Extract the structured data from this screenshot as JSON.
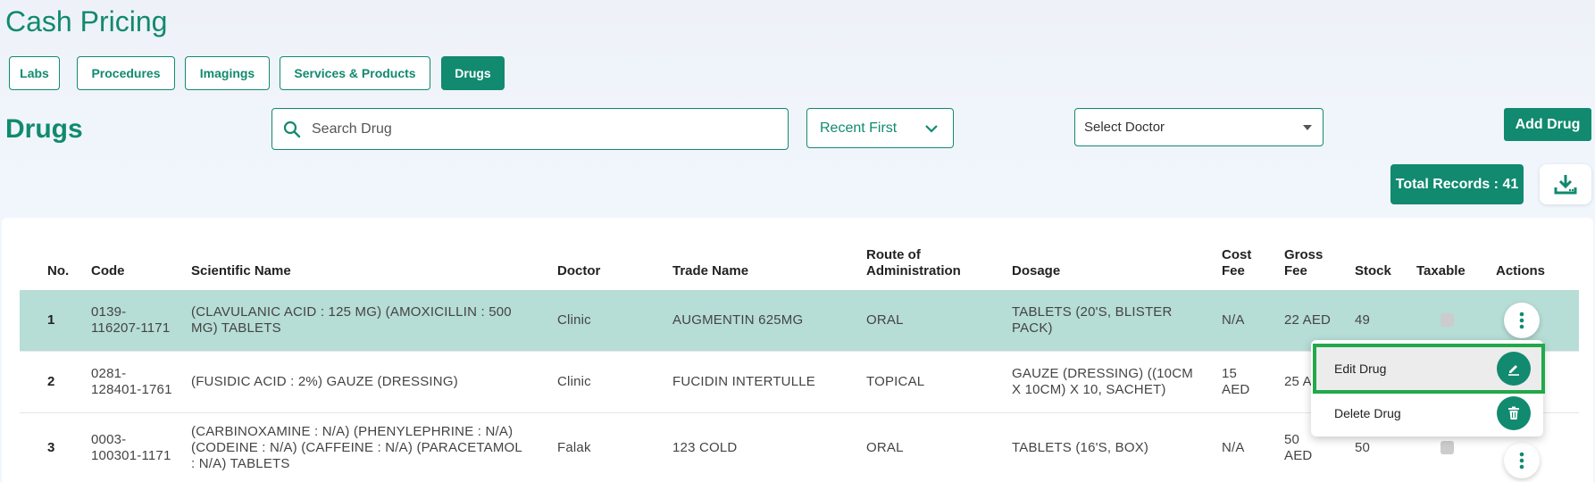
{
  "page": {
    "title": "Cash Pricing"
  },
  "tabs": [
    {
      "label": "Labs",
      "active": false
    },
    {
      "label": "Procedures",
      "active": false
    },
    {
      "label": "Imagings",
      "active": false
    },
    {
      "label": "Services & Products",
      "active": false
    },
    {
      "label": "Drugs",
      "active": true
    }
  ],
  "section": {
    "title": "Drugs"
  },
  "search": {
    "placeholder": "Search Drug",
    "value": ""
  },
  "sort": {
    "selected": "Recent First"
  },
  "doctor_filter": {
    "placeholder": "Select Doctor"
  },
  "add_button": {
    "label": "Add Drug"
  },
  "total": {
    "label": "Total Records : 41"
  },
  "table": {
    "headers": {
      "no": "No.",
      "code": "Code",
      "scientific": "Scientific Name",
      "doctor": "Doctor",
      "trade": "Trade Name",
      "route_1": "Route of",
      "route_2": "Administration",
      "dosage": "Dosage",
      "cost_1": "Cost",
      "cost_2": "Fee",
      "gross_1": "Gross",
      "gross_2": "Fee",
      "stock": "Stock",
      "taxable": "Taxable",
      "actions": "Actions"
    },
    "rows": [
      {
        "no": "1",
        "code_1": "0139-",
        "code_2": "116207-1171",
        "sci_1": "(CLAVULANIC ACID : 125 MG) (AMOXICILLIN : 500",
        "sci_2": "MG) TABLETS",
        "sci_3": "",
        "doctor": "Clinic",
        "trade": "AUGMENTIN 625MG",
        "route": "ORAL",
        "dosage_1": "TABLETS (20'S, BLISTER",
        "dosage_2": "PACK)",
        "cost_1": "N/A",
        "cost_2": "",
        "gross_1": "22 AED",
        "gross_2": "",
        "stock": "49"
      },
      {
        "no": "2",
        "code_1": "0281-",
        "code_2": "128401-1761",
        "sci_1": "(FUSIDIC ACID : 2%) GAUZE (DRESSING)",
        "sci_2": "",
        "sci_3": "",
        "doctor": "Clinic",
        "trade": "FUCIDIN INTERTULLE",
        "route": "TOPICAL",
        "dosage_1": "GAUZE (DRESSING) ((10CM",
        "dosage_2": "X 10CM) X 10, SACHET)",
        "cost_1": "15",
        "cost_2": "AED",
        "gross_1": "25 A",
        "gross_2": "",
        "stock": ""
      },
      {
        "no": "3",
        "code_1": "0003-",
        "code_2": "100301-1171",
        "sci_1": "(CARBINOXAMINE : N/A) (PHENYLEPHRINE : N/A)",
        "sci_2": "(CODEINE : N/A) (CAFFEINE : N/A) (PARACETAMOL",
        "sci_3": ": N/A) TABLETS",
        "doctor": "Falak",
        "trade": "123 COLD",
        "route": "ORAL",
        "dosage_1": "TABLETS (16'S, BOX)",
        "dosage_2": "",
        "cost_1": "N/A",
        "cost_2": "",
        "gross_1": "50",
        "gross_2": "AED",
        "stock": "50"
      }
    ]
  },
  "action_menu": {
    "edit": "Edit Drug",
    "delete": "Delete Drug"
  },
  "colors": {
    "primary": "#118a6f",
    "selected_row": "#b6ddd6",
    "highlight": "#23a84a"
  }
}
